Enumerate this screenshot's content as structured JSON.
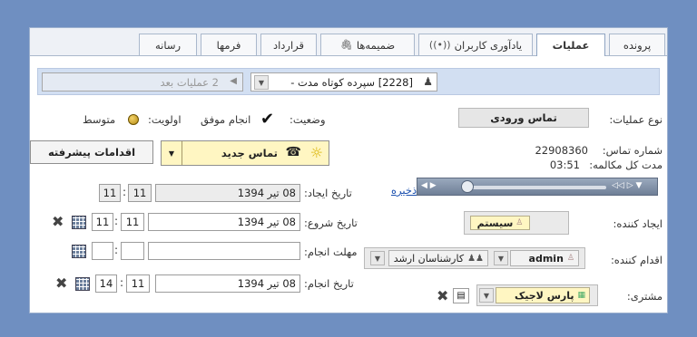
{
  "tabs": [
    {
      "label": "پرونده",
      "active": false
    },
    {
      "label": "عملیات",
      "active": true
    },
    {
      "label": "یادآوری کاربران",
      "active": false
    },
    {
      "label": "ضمیمه‌ها",
      "active": false
    },
    {
      "label": "قرارداد",
      "active": false
    },
    {
      "label": "فرمها",
      "active": false
    },
    {
      "label": "رسانه",
      "active": false
    }
  ],
  "operation_bar": {
    "current": "[2228] سپرده کوتاه مدت -",
    "next": "2 عملیات بعد"
  },
  "form": {
    "op_type_label": "نوع عملیات:",
    "op_type_value": "تماس ورودی",
    "status_label": "وضعیت:",
    "status_value": "انجام موفق",
    "priority_label": "اولویت:",
    "priority_value": "متوسط",
    "new_call_label": "تماس جدید",
    "advanced_label": "اقدامات پیشرفته",
    "call_number_label": "شماره تماس:",
    "call_number_value": "22908360",
    "duration_label": "مدت کل مکالمه:",
    "duration_value": "03:51",
    "save_link": "ذخیره",
    "created_date_label": "تاریخ ایجاد:",
    "created_date_value": "08 تیر 1394",
    "created_hour": "11",
    "created_minute": "11",
    "start_date_label": "تاریخ شروع:",
    "start_date_value": "08 تیر 1394",
    "start_hour": "11",
    "start_minute": "11",
    "deadline_label": "مهلت انجام:",
    "deadline_value": "",
    "deadline_hour": "",
    "deadline_minute": "",
    "done_date_label": "تاریخ انجام:",
    "done_date_value": "08 تیر 1394",
    "done_hour": "14",
    "done_minute": "11",
    "creator_label": "ایجاد کننده:",
    "creator_value": "سیستم",
    "actor_label": "اقدام کننده:",
    "actor_value": "admin",
    "actor_group": "کارشناسان ارشد",
    "customer_label": "مشتری:",
    "customer_value": "پارس لاجیک"
  },
  "colors": {
    "background": "#6f8fc1",
    "opbar": "#d2dff2",
    "highlight": "#fff6c2",
    "link": "#1a4fae"
  }
}
